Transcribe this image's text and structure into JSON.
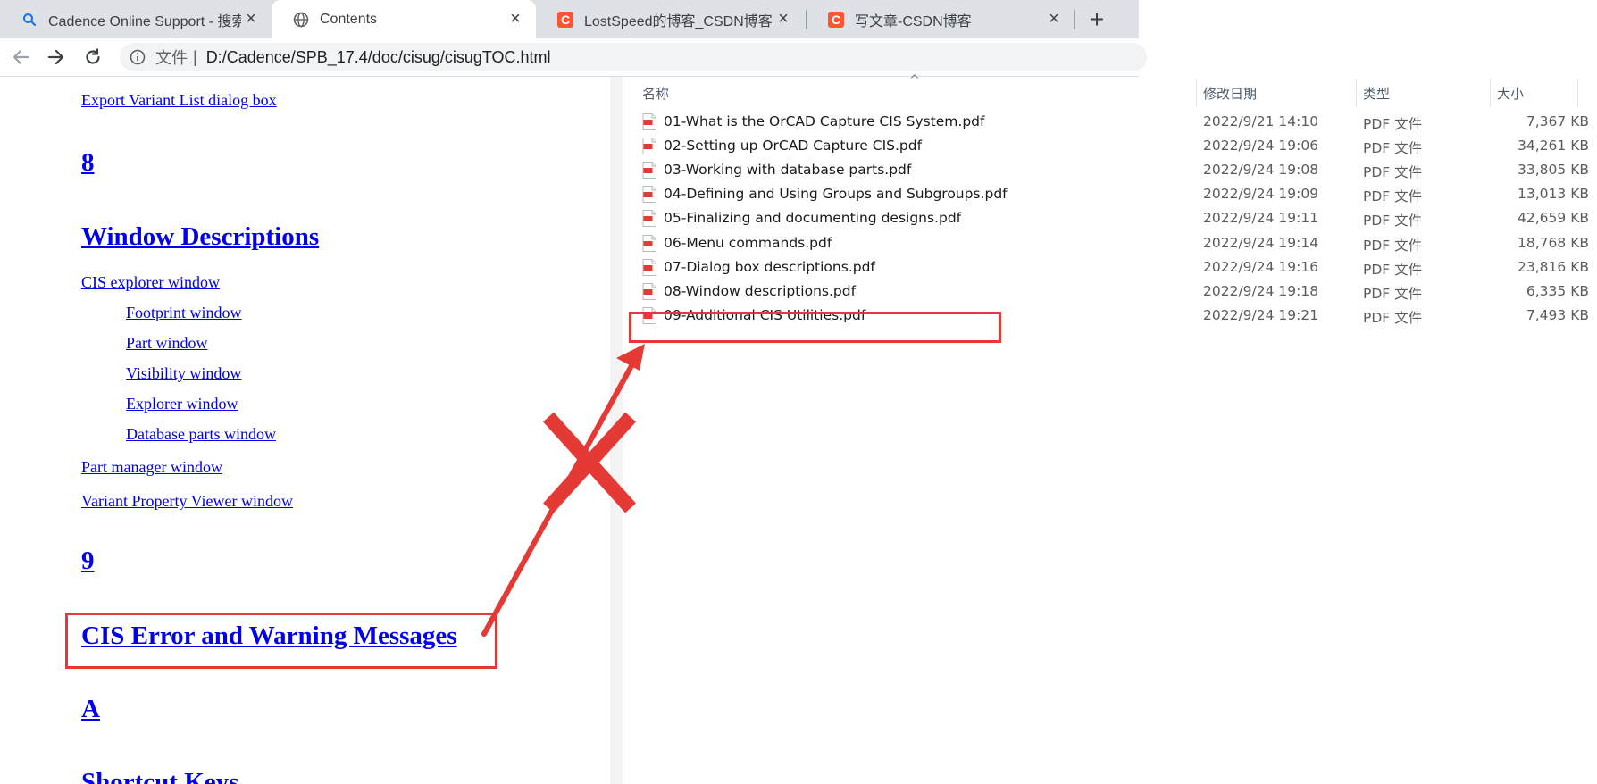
{
  "browser": {
    "tabs": [
      {
        "title": "Cadence Online Support - 搜索",
        "icon": "search-icon",
        "active": false
      },
      {
        "title": "Contents",
        "icon": "globe-icon",
        "active": true
      },
      {
        "title": "LostSpeed的博客_CSDN博客-ST",
        "icon": "csdn-icon",
        "active": false
      },
      {
        "title": "写文章-CSDN博客",
        "icon": "csdn-icon",
        "active": false
      }
    ],
    "csdn_letter": "C",
    "new_tab_label": "+",
    "close_label": "×",
    "address": {
      "scheme_label": "文件",
      "separator": "|",
      "url": "D:/Cadence/SPB_17.4/doc/cisug/cisugTOC.html"
    }
  },
  "doc": {
    "export_variant_link": "Export Variant List dialog box",
    "chapter8_number": "8",
    "chapter8_title": "Window Descriptions",
    "chapter8_links": [
      "CIS explorer window",
      "Footprint window",
      "Part window",
      "Visibility window",
      "Explorer window",
      "Database parts window",
      "Part manager window",
      "Variant Property Viewer window"
    ],
    "chapter9_number": "9",
    "chapter9_title": "CIS Error and Warning Messages",
    "appendixA_number": "A",
    "appendixA_title": "Shortcut Keys"
  },
  "explorer": {
    "columns": {
      "name": "名称",
      "modified": "修改日期",
      "type": "类型",
      "size": "大小"
    },
    "sort_indicator": "^",
    "files": [
      {
        "name": "01-What is the OrCAD Capture CIS System.pdf",
        "modified": "2022/9/21 14:10",
        "type": "PDF 文件",
        "size": "7,367 KB"
      },
      {
        "name": "02-Setting up OrCAD Capture CIS.pdf",
        "modified": "2022/9/24 19:06",
        "type": "PDF 文件",
        "size": "34,261 KB"
      },
      {
        "name": "03-Working with database parts.pdf",
        "modified": "2022/9/24 19:08",
        "type": "PDF 文件",
        "size": "33,805 KB"
      },
      {
        "name": "04-Defining and Using Groups and Subgroups.pdf",
        "modified": "2022/9/24 19:09",
        "type": "PDF 文件",
        "size": "13,013 KB"
      },
      {
        "name": "05-Finalizing and documenting designs.pdf",
        "modified": "2022/9/24 19:11",
        "type": "PDF 文件",
        "size": "42,659 KB"
      },
      {
        "name": "06-Menu commands.pdf",
        "modified": "2022/9/24 19:14",
        "type": "PDF 文件",
        "size": "18,768 KB"
      },
      {
        "name": "07-Dialog box descriptions.pdf",
        "modified": "2022/9/24 19:16",
        "type": "PDF 文件",
        "size": "23,816 KB"
      },
      {
        "name": "08-Window descriptions.pdf",
        "modified": "2022/9/24 19:18",
        "type": "PDF 文件",
        "size": "6,335 KB"
      },
      {
        "name": "09-Additional CIS Utilities.pdf",
        "modified": "2022/9/24 19:21",
        "type": "PDF 文件",
        "size": "7,493 KB"
      }
    ]
  },
  "annotation": {
    "color": "#e53935",
    "meaning": "mismatch-cross"
  }
}
